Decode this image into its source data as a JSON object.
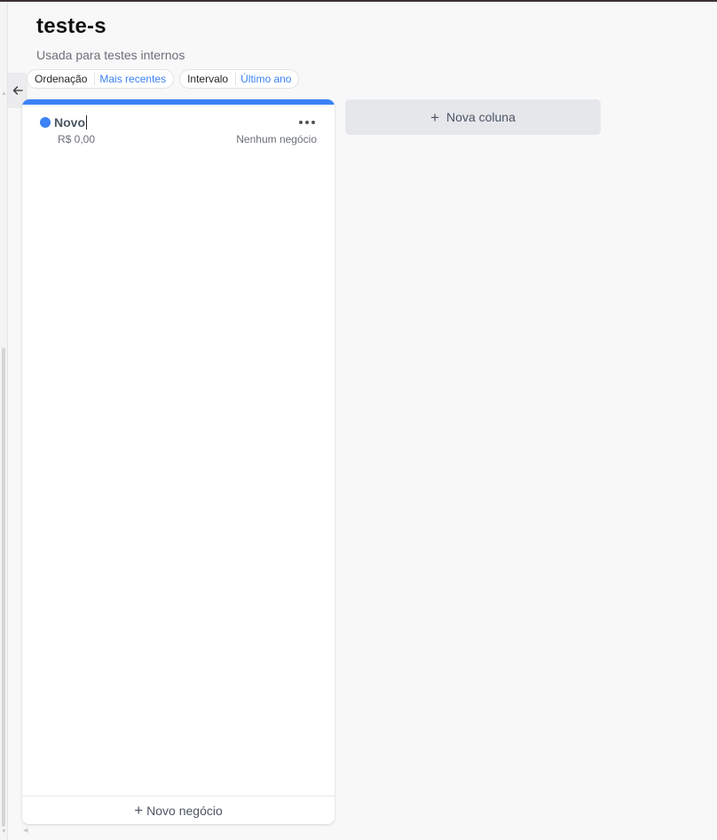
{
  "board": {
    "title": "teste-s",
    "description": "Usada para testes internos"
  },
  "filters": [
    {
      "key": "Ordenação",
      "value": "Mais recentes"
    },
    {
      "key": "Intervalo",
      "value": "Último ano"
    }
  ],
  "columns": [
    {
      "name": "Novo",
      "color": "#3b82f6",
      "total": "R$ 0,00",
      "count_text": "Nenhum negócio",
      "add_label": "Novo negócio"
    }
  ],
  "new_column_label": "Nova coluna",
  "icons": {
    "collapse": "arrow-left-icon",
    "more": "more-horizontal-icon",
    "add": "plus-icon"
  }
}
